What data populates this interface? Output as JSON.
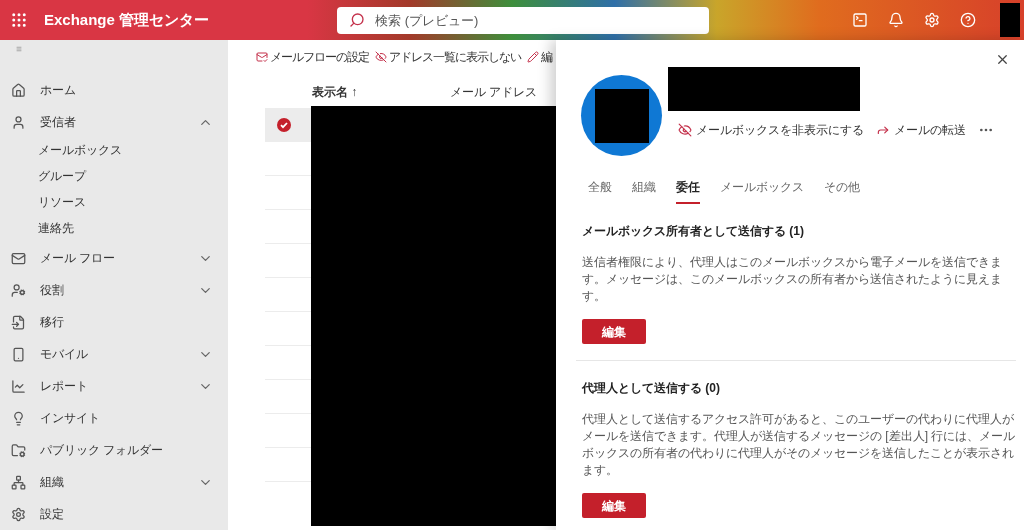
{
  "header": {
    "title": "Exchange 管理センター",
    "search": {
      "placeholder": "検索 (プレビュー)"
    }
  },
  "sidebar": {
    "items": [
      {
        "label": "ホーム"
      },
      {
        "label": "受信者",
        "expanded": true,
        "children": [
          {
            "label": "メールボックス"
          },
          {
            "label": "グループ"
          },
          {
            "label": "リソース"
          },
          {
            "label": "連絡先"
          }
        ]
      },
      {
        "label": "メール フロー",
        "expanded": false
      },
      {
        "label": "役割",
        "expanded": false
      },
      {
        "label": "移行"
      },
      {
        "label": "モバイル",
        "expanded": false
      },
      {
        "label": "レポート",
        "expanded": false
      },
      {
        "label": "インサイト"
      },
      {
        "label": "パブリック フォルダー"
      },
      {
        "label": "組織",
        "expanded": false
      },
      {
        "label": "設定"
      }
    ]
  },
  "toolbar": [
    "メールフローの設定",
    "アドレス一覧に表示しない",
    "編"
  ],
  "table": {
    "columns": [
      "表示名 ↑",
      "メール アドレス"
    ],
    "rows": [
      {
        "selected": true
      },
      {
        "selected": false
      },
      {
        "selected": false
      },
      {
        "selected": false
      },
      {
        "selected": false
      },
      {
        "selected": false
      },
      {
        "selected": false
      },
      {
        "selected": false
      },
      {
        "selected": false
      },
      {
        "selected": false
      },
      {
        "selected": false
      }
    ]
  },
  "panel": {
    "actions": [
      "メールボックスを非表示にする",
      "メールの転送"
    ],
    "tabs": [
      {
        "label": "全般",
        "selected": false
      },
      {
        "label": "組織",
        "selected": false
      },
      {
        "label": "委任",
        "selected": true
      },
      {
        "label": "メールボックス",
        "selected": false
      },
      {
        "label": "その他",
        "selected": false
      }
    ],
    "sections": [
      {
        "heading": "メールボックス所有者として送信する (1)",
        "description": "送信者権限により、代理人はこのメールボックスから電子メールを送信できます。メッセージは、このメールボックスの所有者から送信されたように見えます。",
        "button": "編集"
      },
      {
        "heading": "代理人として送信する (0)",
        "description": "代理人として送信するアクセス許可があると、このユーザーの代わりに代理人がメールを送信できます。代理人が送信するメッセージの [差出人] 行には、メールボックスの所有者の代わりに代理人がそのメッセージを送信したことが表示されます。",
        "button": "編集"
      }
    ]
  }
}
